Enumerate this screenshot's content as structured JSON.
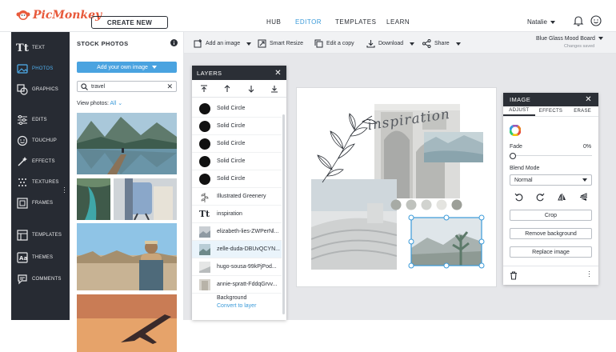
{
  "app": {
    "logo_text": "PicMonkey",
    "create_button": "CREATE NEW"
  },
  "nav": {
    "hub": "HUB",
    "editor": "EDITOR",
    "templates": "TEMPLATES",
    "learn": "LEARN"
  },
  "user": {
    "name": "Natalie"
  },
  "rail": {
    "items": [
      {
        "label": "TEXT",
        "icon": "text-icon"
      },
      {
        "label": "PHOTOS",
        "icon": "photos-icon"
      },
      {
        "label": "GRAPHICS",
        "icon": "graphics-icon"
      },
      {
        "label": "EDITS",
        "icon": "edits-icon"
      },
      {
        "label": "TOUCHUP",
        "icon": "touchup-icon"
      },
      {
        "label": "EFFECTS",
        "icon": "effects-icon"
      },
      {
        "label": "TEXTURES",
        "icon": "textures-icon"
      },
      {
        "label": "FRAMES",
        "icon": "frames-icon"
      },
      {
        "label": "TEMPLATES",
        "icon": "templates-icon"
      },
      {
        "label": "THEMES",
        "icon": "themes-icon"
      },
      {
        "label": "COMMENTS",
        "icon": "comments-icon"
      }
    ]
  },
  "stock": {
    "title": "STOCK PHOTOS",
    "add_own": "Add your own image",
    "search_value": "travel",
    "view_photos_label": "View photos:",
    "view_photos_value": "All"
  },
  "toolbar": {
    "add_image": "Add an image",
    "smart_resize": "Smart Resize",
    "edit_copy": "Edit a copy",
    "download": "Download",
    "share": "Share"
  },
  "document": {
    "title": "Blue Glass Mood Board",
    "status": "Changes saved"
  },
  "layers": {
    "title": "LAYERS",
    "rows": [
      {
        "label": "Solid Circle",
        "kind": "circle"
      },
      {
        "label": "Solid Circle",
        "kind": "circle"
      },
      {
        "label": "Solid Circle",
        "kind": "circle"
      },
      {
        "label": "Solid Circle",
        "kind": "circle"
      },
      {
        "label": "Solid Circle",
        "kind": "circle"
      },
      {
        "label": "Illustrated Greenery",
        "kind": "greenery"
      },
      {
        "label": "inspiration",
        "kind": "text"
      },
      {
        "label": "elizabeth-lies-ZWPerNl...",
        "kind": "image"
      },
      {
        "label": "zelle-duda-DBUvQCYN...",
        "kind": "image"
      },
      {
        "label": "hugo-sousa-99kPjPod...",
        "kind": "image"
      },
      {
        "label": "annie-spratt-FddqGrvv...",
        "kind": "image"
      }
    ],
    "background_label": "Background",
    "convert_label": "Convert to layer"
  },
  "canvas": {
    "inspiration_text": "inspiration"
  },
  "image_panel": {
    "title": "IMAGE",
    "tabs": [
      "ADJUST",
      "EFFECTS",
      "ERASE"
    ],
    "fade_label": "Fade",
    "fade_value": "0%",
    "blend_label": "Blend Mode",
    "blend_value": "Normal",
    "crop": "Crop",
    "remove_bg": "Remove background",
    "replace": "Replace image"
  },
  "colors": {
    "accent": "#3a9ad9",
    "rail_bg": "#272b33",
    "panel_header": "#2b2f36",
    "logo": "#e85a3c",
    "swatches": [
      "#a7aba5",
      "#bfc2bd",
      "#d1d3cf",
      "#e4e4e0",
      "#9c9f98"
    ]
  }
}
